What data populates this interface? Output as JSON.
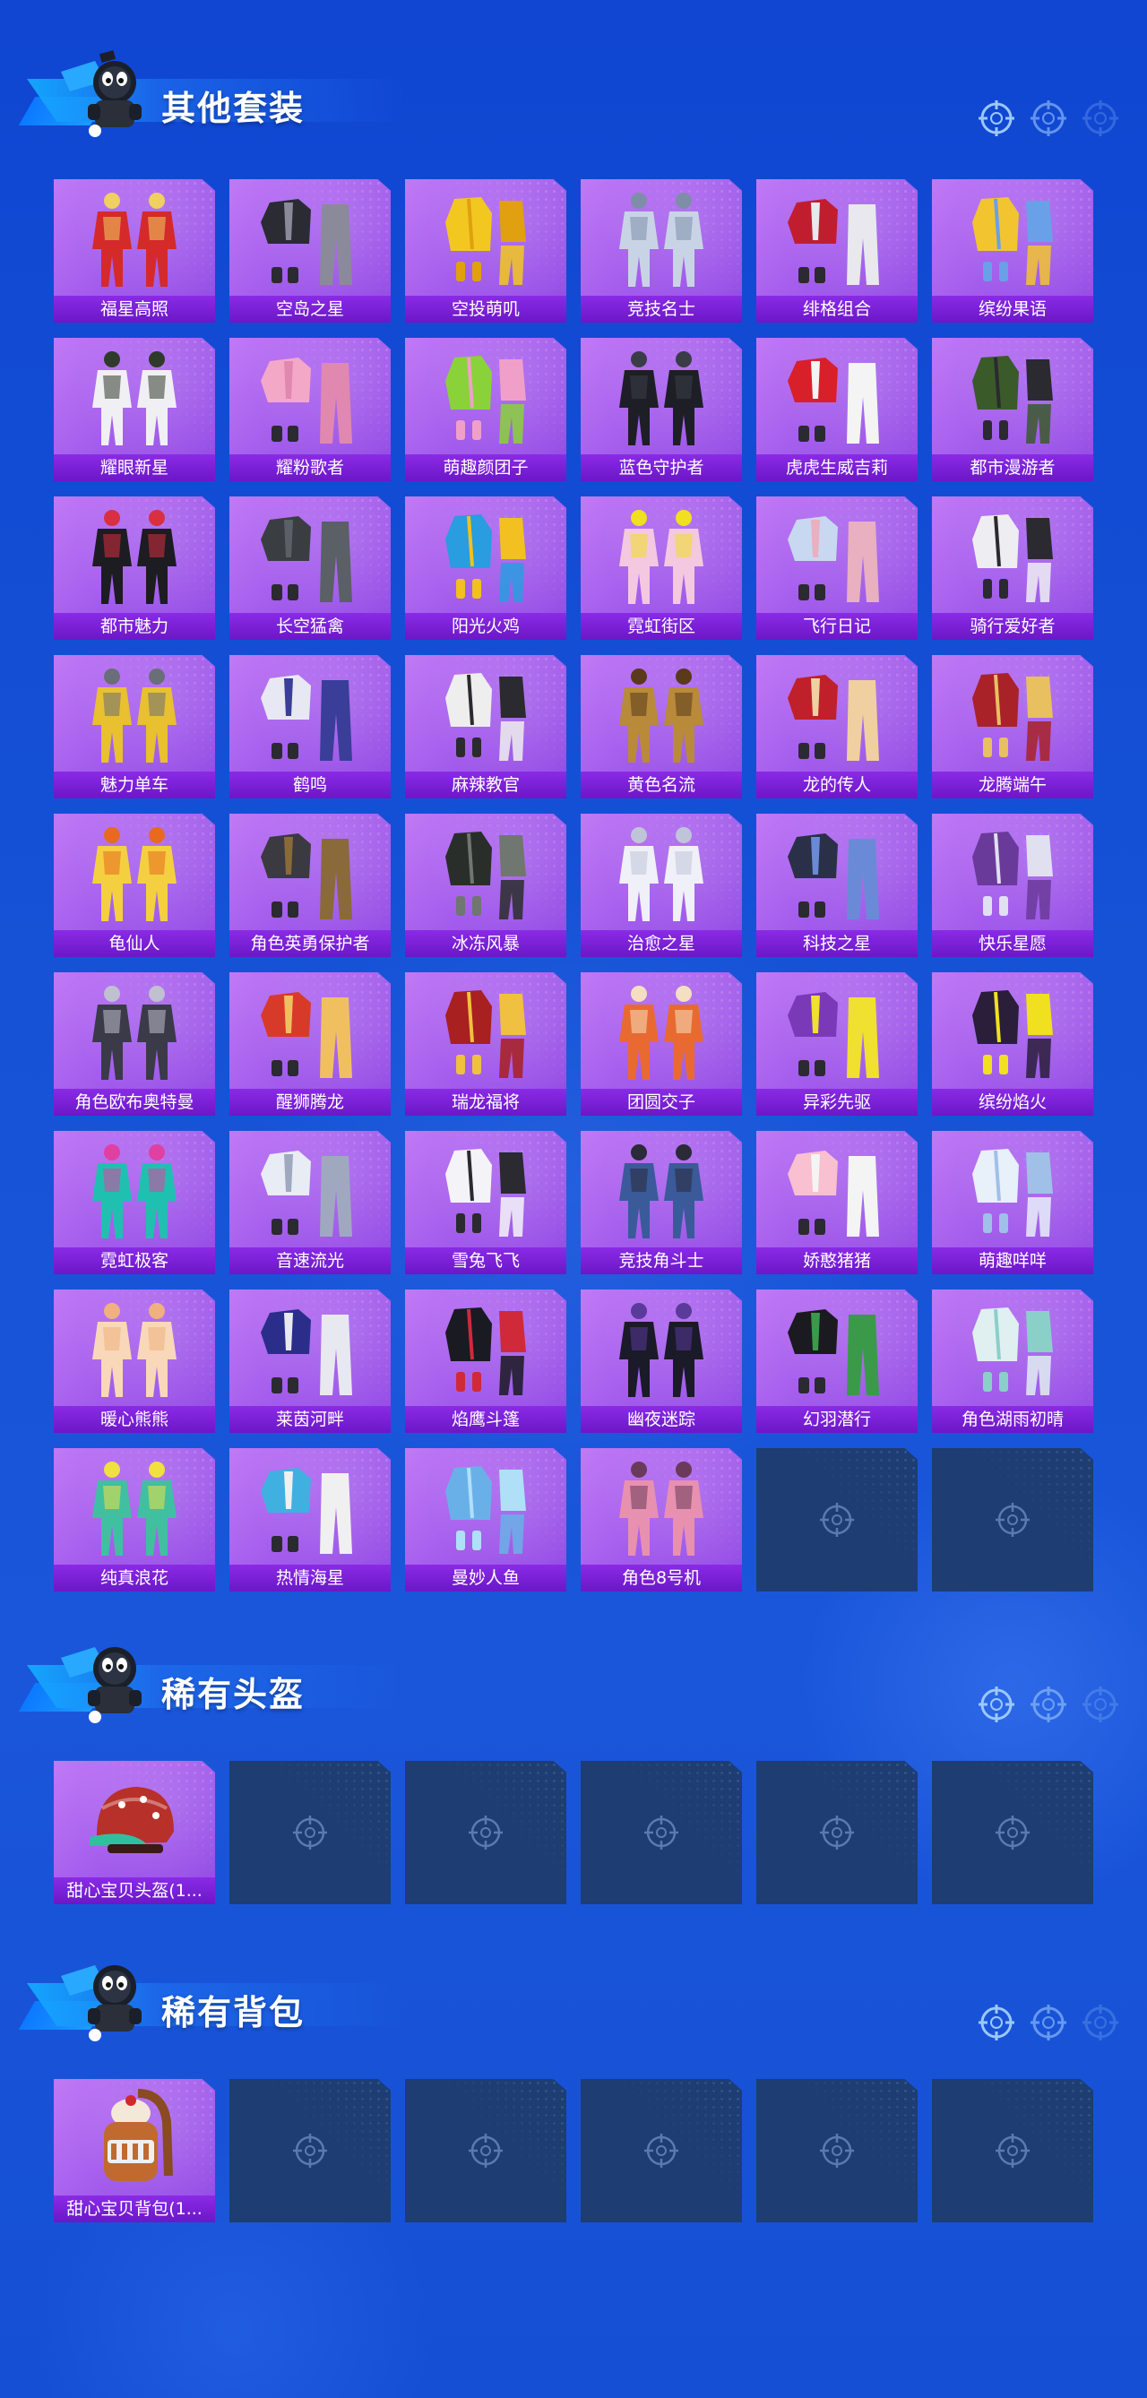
{
  "sections": [
    {
      "title": "其他套装",
      "items": [
        {
          "name": "福星高照",
          "color": "#d42a2a",
          "accent": "#f0d060"
        },
        {
          "name": "空岛之星",
          "color": "#2b2b33",
          "accent": "#8a8a9a"
        },
        {
          "name": "空投萌叽",
          "color": "#f2c820",
          "accent": "#e0a010"
        },
        {
          "name": "竞技名士",
          "color": "#c8d4e6",
          "accent": "#7e8ea8"
        },
        {
          "name": "绯格组合",
          "color": "#c01e2e",
          "accent": "#e8e8ee"
        },
        {
          "name": "缤纷果语",
          "color": "#f2c430",
          "accent": "#6aa0e8"
        },
        {
          "name": "耀眼新星",
          "color": "#f0f0f4",
          "accent": "#2f3a2a"
        },
        {
          "name": "耀粉歌者",
          "color": "#f4a8c8",
          "accent": "#e088b0"
        },
        {
          "name": "萌趣颜团子",
          "color": "#8ad23a",
          "accent": "#f0a0c8"
        },
        {
          "name": "蓝色守护者",
          "color": "#1e1f26",
          "accent": "#3a3c48"
        },
        {
          "name": "虎虎生威吉莉",
          "color": "#d8202a",
          "accent": "#f4f4f4"
        },
        {
          "name": "都市漫游者",
          "color": "#3a5a2a",
          "accent": "#2a2a30"
        },
        {
          "name": "都市魅力",
          "color": "#1c1c22",
          "accent": "#d83040"
        },
        {
          "name": "长空猛禽",
          "color": "#3a3e42",
          "accent": "#5a6066"
        },
        {
          "name": "阳光火鸡",
          "color": "#2a9ce0",
          "accent": "#f2c020"
        },
        {
          "name": "霓虹街区",
          "color": "#f4c8e0",
          "accent": "#f0e020"
        },
        {
          "name": "飞行日记",
          "color": "#c8d8f0",
          "accent": "#e8b0c0"
        },
        {
          "name": "骑行爱好者",
          "color": "#eeeeF2",
          "accent": "#2a2a30"
        },
        {
          "name": "魅力单车",
          "color": "#e8c030",
          "accent": "#6a6e78"
        },
        {
          "name": "鹤鸣",
          "color": "#e8e8f4",
          "accent": "#3a3e98"
        },
        {
          "name": "麻辣教官",
          "color": "#eeeeee",
          "accent": "#2a2a30"
        },
        {
          "name": "黄色名流",
          "color": "#b88a3a",
          "accent": "#5a3a1a"
        },
        {
          "name": "龙的传人",
          "color": "#c0202a",
          "accent": "#f0d0a0"
        },
        {
          "name": "龙腾端午",
          "color": "#a82228",
          "accent": "#e8c060"
        },
        {
          "name": "龟仙人",
          "color": "#f4d040",
          "accent": "#e86a20"
        },
        {
          "name": "角色英勇保护者",
          "color": "#3a3a40",
          "accent": "#8a6a3a"
        },
        {
          "name": "冰冻风暴",
          "color": "#2a2e2a",
          "accent": "#707670"
        },
        {
          "name": "治愈之星",
          "color": "#f0f0f8",
          "accent": "#c0c4d8"
        },
        {
          "name": "科技之星",
          "color": "#2a3048",
          "accent": "#6a8ad8"
        },
        {
          "name": "快乐星愿",
          "color": "#6a3a9a",
          "accent": "#e0e0f0"
        },
        {
          "name": "角色欧布奥特曼",
          "color": "#3a3a48",
          "accent": "#c0c0d0"
        },
        {
          "name": "醒狮腾龙",
          "color": "#d83a2a",
          "accent": "#f0c060"
        },
        {
          "name": "瑞龙福将",
          "color": "#a82020",
          "accent": "#f0c040"
        },
        {
          "name": "团圆交子",
          "color": "#e86a30",
          "accent": "#f4e0c0"
        },
        {
          "name": "异彩先驱",
          "color": "#7a3ab8",
          "accent": "#f0e030"
        },
        {
          "name": "缤纷焰火",
          "color": "#2a1e3a",
          "accent": "#f0e020"
        },
        {
          "name": "霓虹极客",
          "color": "#20c0b0",
          "accent": "#e040a0"
        },
        {
          "name": "音速流光",
          "color": "#e8ecf4",
          "accent": "#a0a8c0"
        },
        {
          "name": "雪兔飞飞",
          "color": "#f4f4f8",
          "accent": "#2a2a30"
        },
        {
          "name": "竞技角斗士",
          "color": "#3a5a9a",
          "accent": "#2a2a38"
        },
        {
          "name": "娇憨猪猪",
          "color": "#f8c0d0",
          "accent": "#f4f4f4"
        },
        {
          "name": "萌趣咩咩",
          "color": "#e8f0fa",
          "accent": "#a0c0e8"
        },
        {
          "name": "暖心熊熊",
          "color": "#f8d8b8",
          "accent": "#f0b080"
        },
        {
          "name": "莱茵河畔",
          "color": "#2a2e8a",
          "accent": "#e8e8f0"
        },
        {
          "name": "焰鹰斗篷",
          "color": "#1a1a22",
          "accent": "#d02a3a"
        },
        {
          "name": "幽夜迷踪",
          "color": "#1a1a28",
          "accent": "#5a3a9a"
        },
        {
          "name": "幻羽潜行",
          "color": "#1a1a20",
          "accent": "#3a9a4a"
        },
        {
          "name": "角色湖雨初晴",
          "color": "#e0f0f0",
          "accent": "#8ad0c8"
        },
        {
          "name": "纯真浪花",
          "color": "#40c0a0",
          "accent": "#f0e040"
        },
        {
          "name": "热情海星",
          "color": "#40b0e0",
          "accent": "#f0f0f0"
        },
        {
          "name": "曼妙人鱼",
          "color": "#6ab0e8",
          "accent": "#b0e0f8"
        },
        {
          "name": "角色8号机",
          "color": "#e890b0",
          "accent": "#6a3a5a"
        },
        null,
        null
      ]
    },
    {
      "title": "稀有头盔",
      "items": [
        {
          "name": "甜心宝贝头盔(1...",
          "color": "#b8302a",
          "accent": "#30c0a0",
          "kind": "helmet"
        },
        null,
        null,
        null,
        null,
        null
      ]
    },
    {
      "title": "稀有背包",
      "items": [
        {
          "name": "甜心宝贝背包(1...",
          "color": "#c06a30",
          "accent": "#f0f0f0",
          "kind": "backpack"
        },
        null,
        null,
        null,
        null,
        null
      ]
    }
  ]
}
